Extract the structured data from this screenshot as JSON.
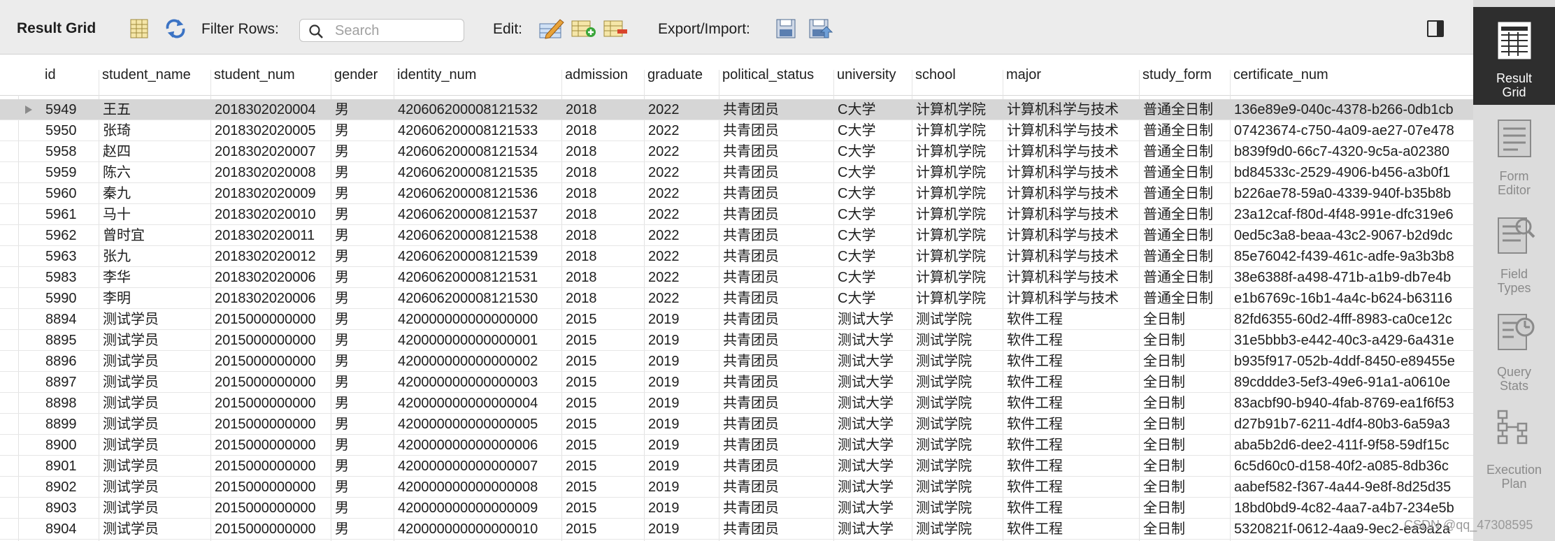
{
  "toolbar": {
    "title": "Result Grid",
    "filter_label": "Filter Rows:",
    "search_placeholder": "Search",
    "edit_label": "Edit:",
    "export_label": "Export/Import:"
  },
  "columns": [
    "id",
    "student_name",
    "student_num",
    "gender",
    "identity_num",
    "admission",
    "graduate",
    "political_status",
    "university",
    "school",
    "major",
    "study_form",
    "certificate_num"
  ],
  "rows": [
    [
      "5949",
      "王五",
      "2018302020004",
      "男",
      "420606200008121532",
      "2018",
      "2022",
      "共青团员",
      "C大学",
      "计算机学院",
      "计算机科学与技术",
      "普通全日制",
      "136e89e9-040c-4378-b266-0db1cb"
    ],
    [
      "5950",
      "张琦",
      "2018302020005",
      "男",
      "420606200008121533",
      "2018",
      "2022",
      "共青团员",
      "C大学",
      "计算机学院",
      "计算机科学与技术",
      "普通全日制",
      "07423674-c750-4a09-ae27-07e478"
    ],
    [
      "5958",
      "赵四",
      "2018302020007",
      "男",
      "420606200008121534",
      "2018",
      "2022",
      "共青团员",
      "C大学",
      "计算机学院",
      "计算机科学与技术",
      "普通全日制",
      "b839f9d0-66c7-4320-9c5a-a02380"
    ],
    [
      "5959",
      "陈六",
      "2018302020008",
      "男",
      "420606200008121535",
      "2018",
      "2022",
      "共青团员",
      "C大学",
      "计算机学院",
      "计算机科学与技术",
      "普通全日制",
      "bd84533c-2529-4906-b456-a3b0f1"
    ],
    [
      "5960",
      "秦九",
      "2018302020009",
      "男",
      "420606200008121536",
      "2018",
      "2022",
      "共青团员",
      "C大学",
      "计算机学院",
      "计算机科学与技术",
      "普通全日制",
      "b226ae78-59a0-4339-940f-b35b8b"
    ],
    [
      "5961",
      "马十",
      "2018302020010",
      "男",
      "420606200008121537",
      "2018",
      "2022",
      "共青团员",
      "C大学",
      "计算机学院",
      "计算机科学与技术",
      "普通全日制",
      "23a12caf-f80d-4f48-991e-dfc319e6"
    ],
    [
      "5962",
      "曾时宜",
      "2018302020011",
      "男",
      "420606200008121538",
      "2018",
      "2022",
      "共青团员",
      "C大学",
      "计算机学院",
      "计算机科学与技术",
      "普通全日制",
      "0ed5c3a8-beaa-43c2-9067-b2d9dc"
    ],
    [
      "5963",
      "张九",
      "2018302020012",
      "男",
      "420606200008121539",
      "2018",
      "2022",
      "共青团员",
      "C大学",
      "计算机学院",
      "计算机科学与技术",
      "普通全日制",
      "85e76042-f439-461c-adfe-9a3b3b8"
    ],
    [
      "5983",
      "李华",
      "2018302020006",
      "男",
      "420606200008121531",
      "2018",
      "2022",
      "共青团员",
      "C大学",
      "计算机学院",
      "计算机科学与技术",
      "普通全日制",
      "38e6388f-a498-471b-a1b9-db7e4b"
    ],
    [
      "5990",
      "李明",
      "2018302020006",
      "男",
      "420606200008121530",
      "2018",
      "2022",
      "共青团员",
      "C大学",
      "计算机学院",
      "计算机科学与技术",
      "普通全日制",
      "e1b6769c-16b1-4a4c-b624-b63116"
    ],
    [
      "8894",
      "测试学员",
      "2015000000000",
      "男",
      "420000000000000000",
      "2015",
      "2019",
      "共青团员",
      "测试大学",
      "测试学院",
      "软件工程",
      "全日制",
      "82fd6355-60d2-4fff-8983-ca0ce12c"
    ],
    [
      "8895",
      "测试学员",
      "2015000000000",
      "男",
      "420000000000000001",
      "2015",
      "2019",
      "共青团员",
      "测试大学",
      "测试学院",
      "软件工程",
      "全日制",
      "31e5bbb3-e442-40c3-a429-6a431e"
    ],
    [
      "8896",
      "测试学员",
      "2015000000000",
      "男",
      "420000000000000002",
      "2015",
      "2019",
      "共青团员",
      "测试大学",
      "测试学院",
      "软件工程",
      "全日制",
      "b935f917-052b-4ddf-8450-e89455e"
    ],
    [
      "8897",
      "测试学员",
      "2015000000000",
      "男",
      "420000000000000003",
      "2015",
      "2019",
      "共青团员",
      "测试大学",
      "测试学院",
      "软件工程",
      "全日制",
      "89cddde3-5ef3-49e6-91a1-a0610e"
    ],
    [
      "8898",
      "测试学员",
      "2015000000000",
      "男",
      "420000000000000004",
      "2015",
      "2019",
      "共青团员",
      "测试大学",
      "测试学院",
      "软件工程",
      "全日制",
      "83acbf90-b940-4fab-8769-ea1f6f53"
    ],
    [
      "8899",
      "测试学员",
      "2015000000000",
      "男",
      "420000000000000005",
      "2015",
      "2019",
      "共青团员",
      "测试大学",
      "测试学院",
      "软件工程",
      "全日制",
      "d27b91b7-6211-4df4-80b3-6a59a3"
    ],
    [
      "8900",
      "测试学员",
      "2015000000000",
      "男",
      "420000000000000006",
      "2015",
      "2019",
      "共青团员",
      "测试大学",
      "测试学院",
      "软件工程",
      "全日制",
      "aba5b2d6-dee2-411f-9f58-59df15c"
    ],
    [
      "8901",
      "测试学员",
      "2015000000000",
      "男",
      "420000000000000007",
      "2015",
      "2019",
      "共青团员",
      "测试大学",
      "测试学院",
      "软件工程",
      "全日制",
      "6c5d60c0-d158-40f2-a085-8db36c"
    ],
    [
      "8902",
      "测试学员",
      "2015000000000",
      "男",
      "420000000000000008",
      "2015",
      "2019",
      "共青团员",
      "测试大学",
      "测试学院",
      "软件工程",
      "全日制",
      "aabef582-f367-4a44-9e8f-8d25d35"
    ],
    [
      "8903",
      "测试学员",
      "2015000000000",
      "男",
      "420000000000000009",
      "2015",
      "2019",
      "共青团员",
      "测试大学",
      "测试学院",
      "软件工程",
      "全日制",
      "18bd0bd9-4c82-4aa7-a4b7-234e5b"
    ],
    [
      "8904",
      "测试学员",
      "2015000000000",
      "男",
      "420000000000000010",
      "2015",
      "2019",
      "共青团员",
      "测试大学",
      "测试学院",
      "软件工程",
      "全日制",
      "5320821f-0612-4aa9-9ec2-ea9a2a"
    ]
  ],
  "selected_row": 0,
  "sidebar": {
    "items": [
      {
        "label_1": "Result",
        "label_2": "Grid",
        "icon": "result-grid-icon"
      },
      {
        "label_1": "Form",
        "label_2": "Editor",
        "icon": "form-editor-icon"
      },
      {
        "label_1": "Field",
        "label_2": "Types",
        "icon": "field-types-icon"
      },
      {
        "label_1": "Query",
        "label_2": "Stats",
        "icon": "query-stats-icon"
      },
      {
        "label_1": "Execution",
        "label_2": "Plan",
        "icon": "execution-plan-icon"
      }
    ],
    "active_index": 0
  },
  "watermark": "CSDN @qq_47308595",
  "colors": {
    "toolbar_bg": "#ececec",
    "sidebar_bg": "#dcdcdc",
    "sidebar_active": "#2e2e2e",
    "selected_row": "#d6d6d6"
  }
}
